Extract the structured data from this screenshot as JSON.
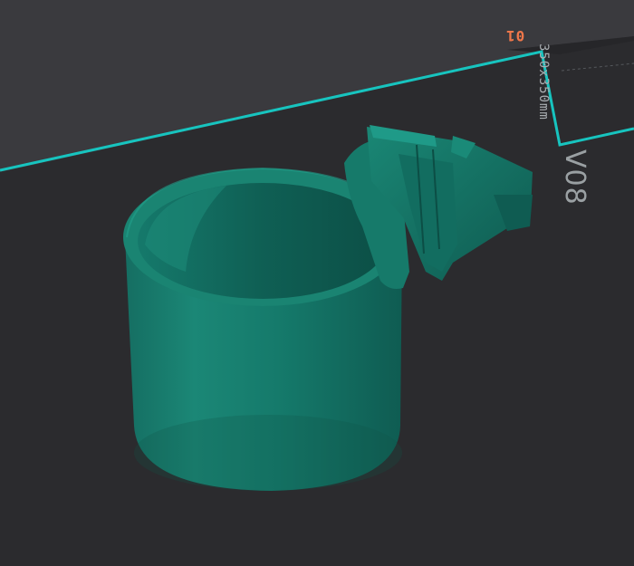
{
  "plate": {
    "number_label": "01",
    "dimensions_label": "350x350mm",
    "model_label": "V08"
  },
  "colors": {
    "background": "#3a3a3e",
    "plate_surface": "#2b2b2e",
    "plate_edge": "#17c4bf",
    "plate_number": "#f0774a",
    "model_main": "#14786a",
    "model_shadow": "#0e5a4f",
    "model_highlight": "#1f9a88"
  }
}
